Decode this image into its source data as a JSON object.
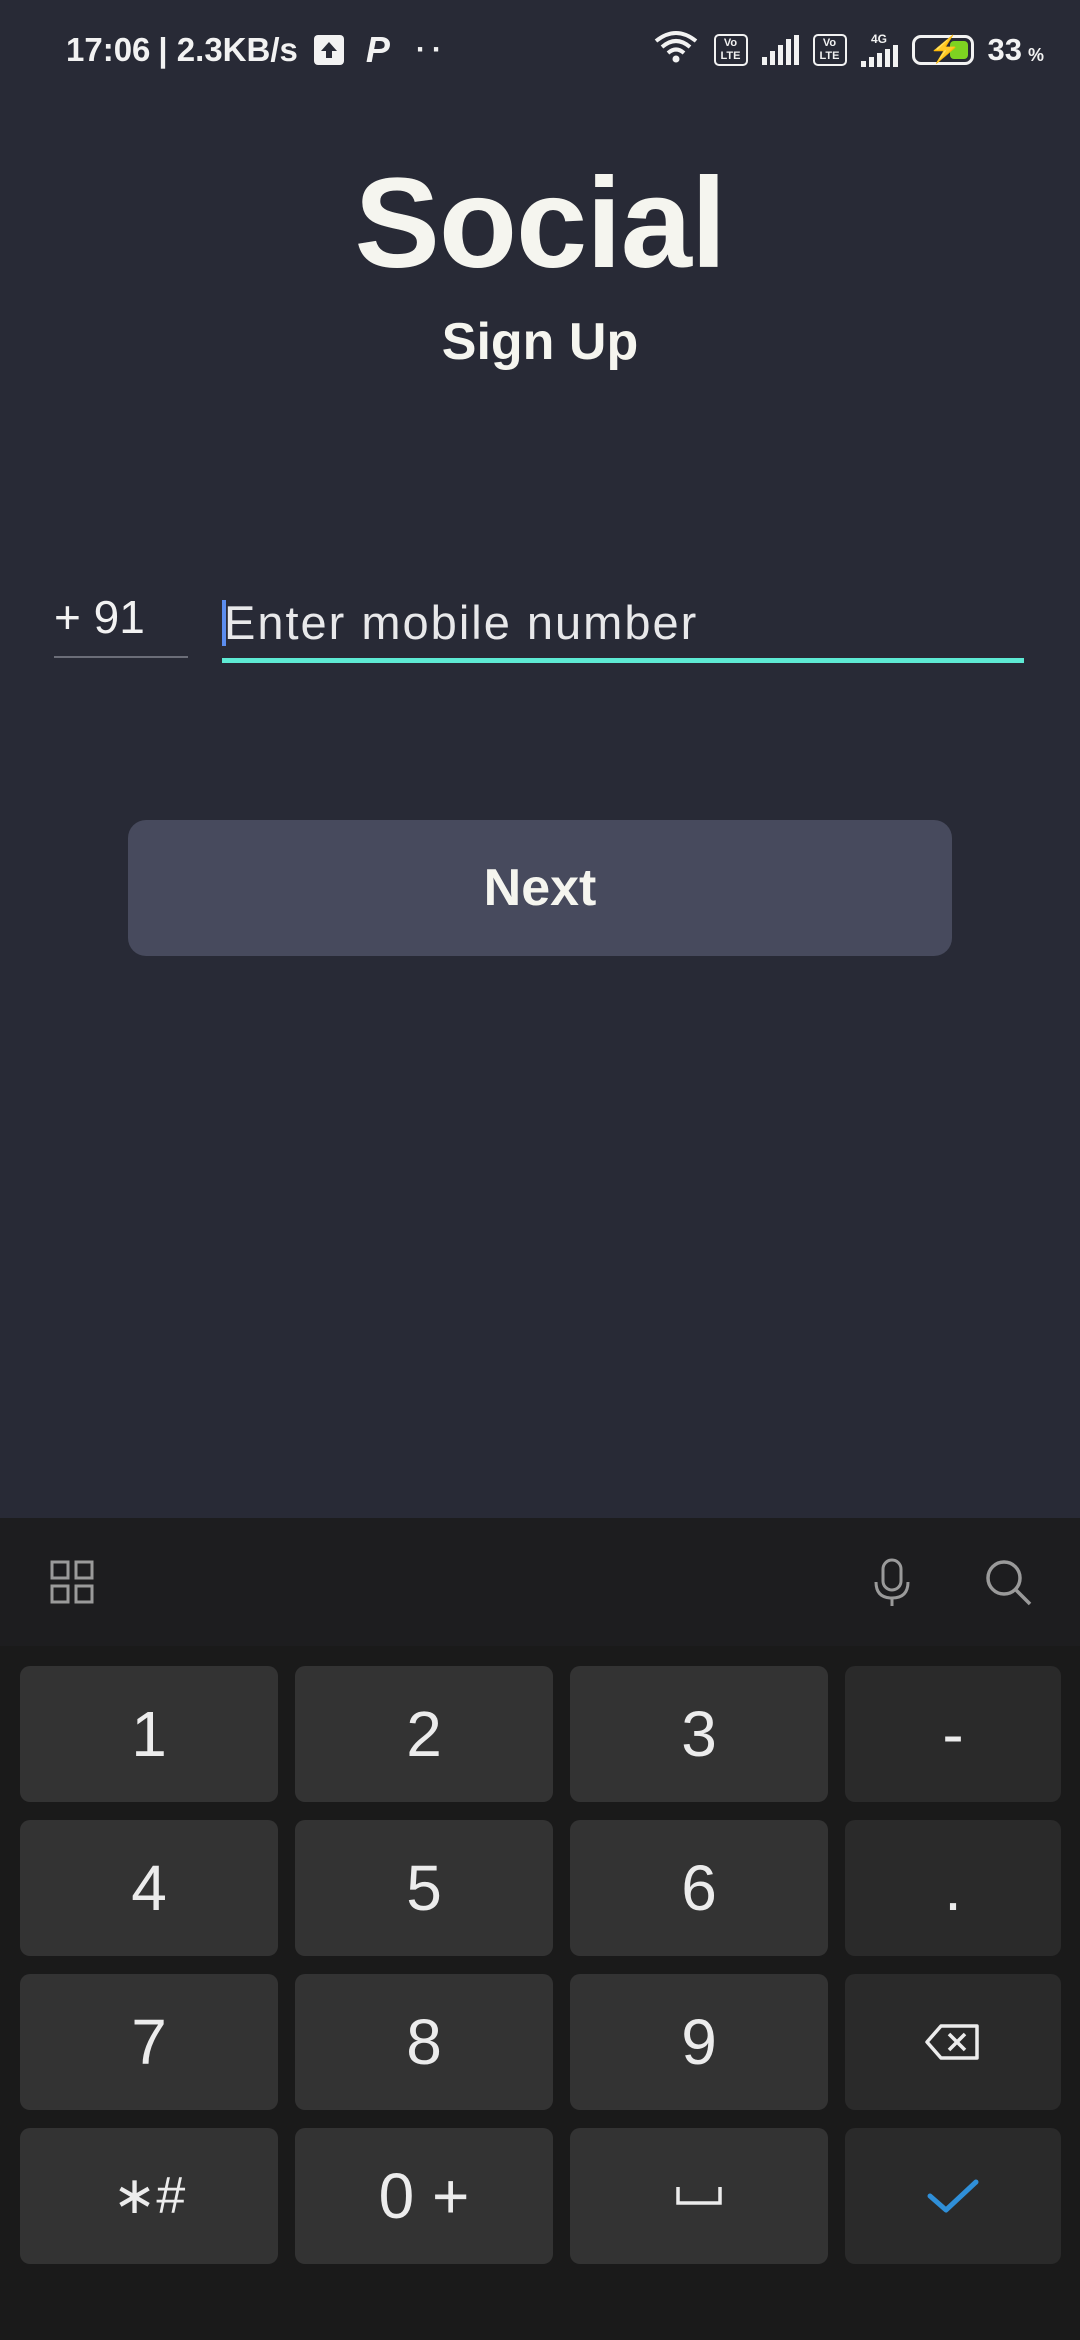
{
  "status_bar": {
    "time": "17:06",
    "net_speed": "| 2.3KB/s",
    "p_label": "P",
    "dots": "··",
    "lte1": "Vo\nLTE",
    "lte2": "Vo\nLTE",
    "net_type": "4G",
    "battery_percent": "33",
    "battery_sign": "%",
    "battery_level": 0.33
  },
  "header": {
    "app_name": "Social",
    "screen_title": "Sign Up"
  },
  "form": {
    "country_code": "+ 91",
    "phone_value": "",
    "phone_placeholder": "Enter mobile number"
  },
  "actions": {
    "next_label": "Next"
  },
  "keyboard": {
    "keys": [
      [
        "1",
        "2",
        "3",
        "-"
      ],
      [
        "4",
        "5",
        "6",
        "."
      ],
      [
        "7",
        "8",
        "9",
        "backspace-icon"
      ],
      [
        "*#",
        "0 +",
        "space-icon",
        "check-icon"
      ]
    ],
    "labels": {
      "k1": "1",
      "k2": "2",
      "k3": "3",
      "kdash": "-",
      "k4": "4",
      "k5": "5",
      "k6": "6",
      "kdot": ".",
      "k7": "7",
      "k8": "8",
      "k9": "9",
      "kstar": "∗#",
      "k0": "0 +"
    },
    "accent_color": "#2f8fd8"
  },
  "colors": {
    "background": "#282a36",
    "input_underline": "#5eead4",
    "button": "#474a5d"
  }
}
